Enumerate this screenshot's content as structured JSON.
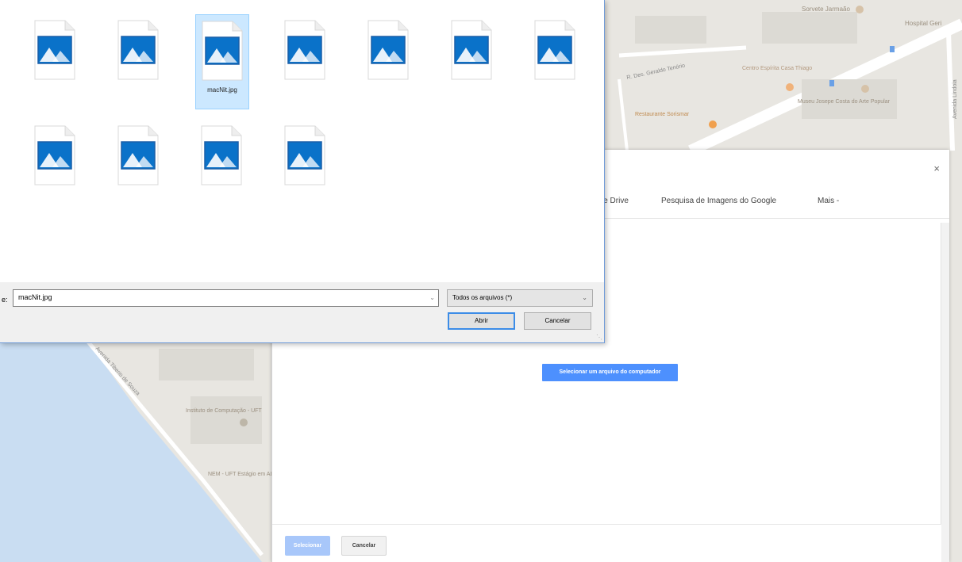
{
  "map": {
    "places": [
      "Sorvete Jarmaão",
      "Hospital Geri",
      "Centro Espírita Casa Thiago",
      "Restaurante Sorismar",
      "Museu Josepe Costa do Arte Popular",
      "Instituto de Computação - UFT",
      "NEM - UFT Estágio em AL"
    ],
    "streets": [
      "R. Des. Geraldo Tenório",
      "Avenida Lindoia",
      "Avenida Tiberio de Souza"
    ]
  },
  "picker": {
    "close_label": "×",
    "tabs": [
      "le Drive",
      "Pesquisa de Imagens do Google",
      "Mais -"
    ],
    "select_file_button": "Selecionar um arquivo do computador",
    "footer": {
      "select_label": "Selecionar",
      "cancel_label": "Cancelar"
    }
  },
  "file_dialog": {
    "files": [
      {
        "name": ""
      },
      {
        "name": ""
      },
      {
        "name": "macNit.jpg",
        "selected": true
      },
      {
        "name": ""
      },
      {
        "name": ""
      },
      {
        "name": ""
      },
      {
        "name": ""
      },
      {
        "name": ""
      },
      {
        "name": ""
      },
      {
        "name": ""
      },
      {
        "name": ""
      }
    ],
    "filename_label": "e:",
    "filename_value": "macNit.jpg",
    "file_type": "Todos os arquivos (*)",
    "open_label": "Abrir",
    "cancel_label": "Cancelar"
  },
  "colors": {
    "water": "#c9ddf2",
    "map": "#e8e6e1",
    "accent": "#4d90fe",
    "selection": "#cce8ff",
    "icon_blue": "#0a72c9"
  }
}
